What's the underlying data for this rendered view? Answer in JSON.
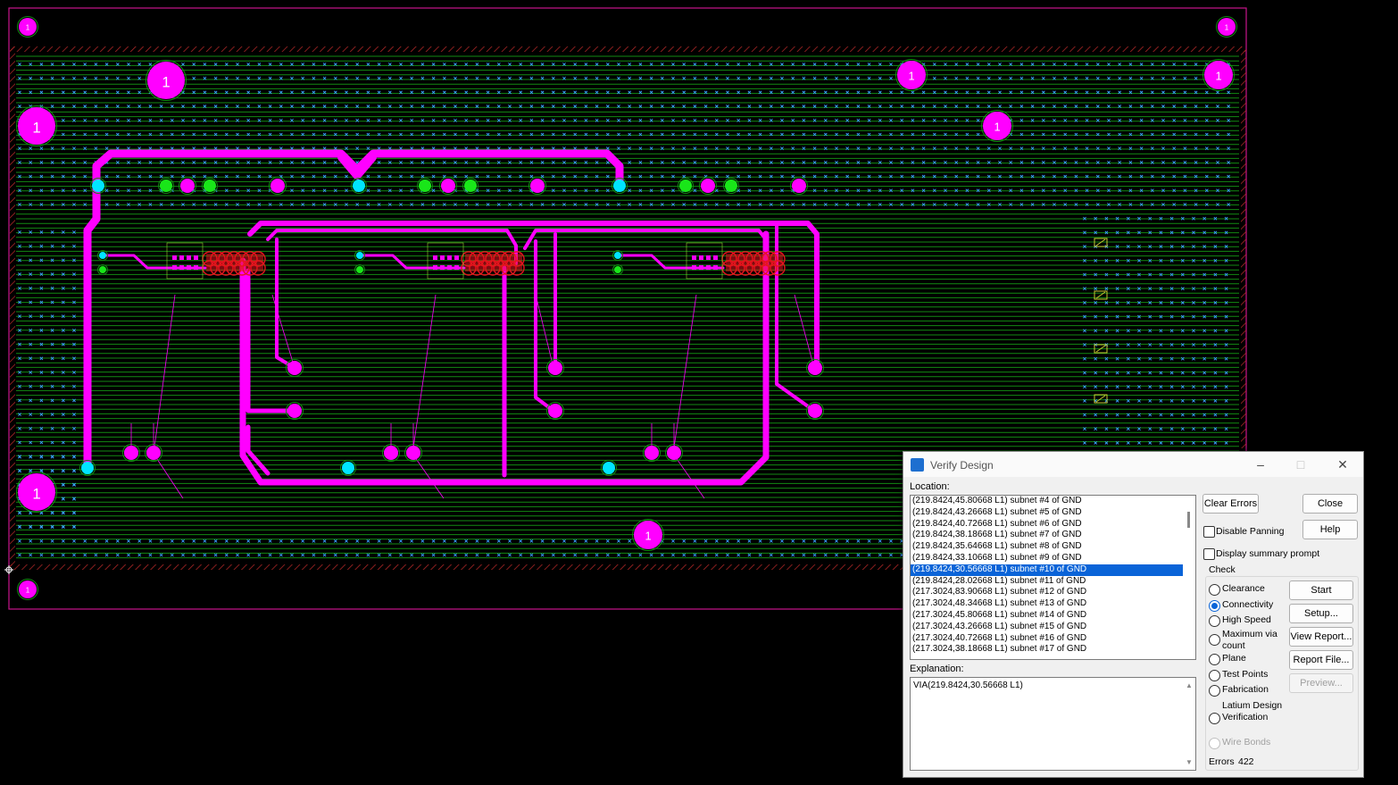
{
  "colors": {
    "board_bg": "#000000",
    "board_outline": "#c8148c",
    "grid_line": "#138a13",
    "trace": "#ff00ff",
    "via_cyan": "#00e5ff",
    "via_green": "#19e619",
    "error_marker": "#e6141e",
    "keepout_hatch": "#b42828",
    "selection": "#0a64d8"
  },
  "pcb": {
    "pad_label": "1"
  },
  "dialog": {
    "icon": "verify-design-app-icon",
    "title": "Verify Design",
    "minimize_icon": "minimize-icon",
    "maximize_icon": "maximize-icon",
    "close_icon": "close-icon",
    "location_label": "Location:",
    "locations": [
      "(219.8424,45.80668 L1) subnet #4 of GND",
      "(219.8424,43.26668 L1) subnet #5 of GND",
      "(219.8424,40.72668 L1) subnet #6 of GND",
      "(219.8424,38.18668 L1) subnet #7 of GND",
      "(219.8424,35.64668 L1) subnet #8 of GND",
      "(219.8424,33.10668 L1) subnet #9 of GND",
      "(219.8424,30.56668 L1) subnet #10 of GND",
      "(219.8424,28.02668 L1) subnet #11 of GND",
      "(217.3024,83.90668 L1) subnet #12 of GND",
      "(217.3024,48.34668 L1) subnet #13 of GND",
      "(217.3024,45.80668 L1) subnet #14 of GND",
      "(217.3024,43.26668 L1) subnet #15 of GND",
      "(217.3024,40.72668 L1) subnet #16 of GND",
      "(217.3024,38.18668 L1) subnet #17 of GND"
    ],
    "selected_location": "(219.8424,30.56668 L1) subnet #10 of GND",
    "explanation_label": "Explanation:",
    "explanation_text": "VIA(219.8424,30.56668 L1)",
    "clear_errors": "Clear Errors",
    "close": "Close",
    "help": "Help",
    "disable_panning": "Disable Panning",
    "disable_panning_checked": false,
    "display_summary_prompt": "Display summary prompt",
    "display_summary_prompt_checked": false,
    "check_label": "Check",
    "checks": [
      {
        "label": "Clearance",
        "selected": false,
        "enabled": true
      },
      {
        "label": "Connectivity",
        "selected": true,
        "enabled": true
      },
      {
        "label": "High Speed",
        "selected": false,
        "enabled": true
      },
      {
        "label": "Maximum via count",
        "selected": false,
        "enabled": true
      },
      {
        "label": "Plane",
        "selected": false,
        "enabled": true
      },
      {
        "label": "Test Points",
        "selected": false,
        "enabled": true
      },
      {
        "label": "Fabrication",
        "selected": false,
        "enabled": true
      },
      {
        "label": "Latium Design Verification",
        "selected": false,
        "enabled": true
      },
      {
        "label": "Wire Bonds",
        "selected": false,
        "enabled": false
      }
    ],
    "start": "Start",
    "setup": "Setup...",
    "view_report": "View Report...",
    "report_file": "Report File...",
    "preview": "Preview...",
    "errors_label": "Errors",
    "errors_count": "422"
  }
}
